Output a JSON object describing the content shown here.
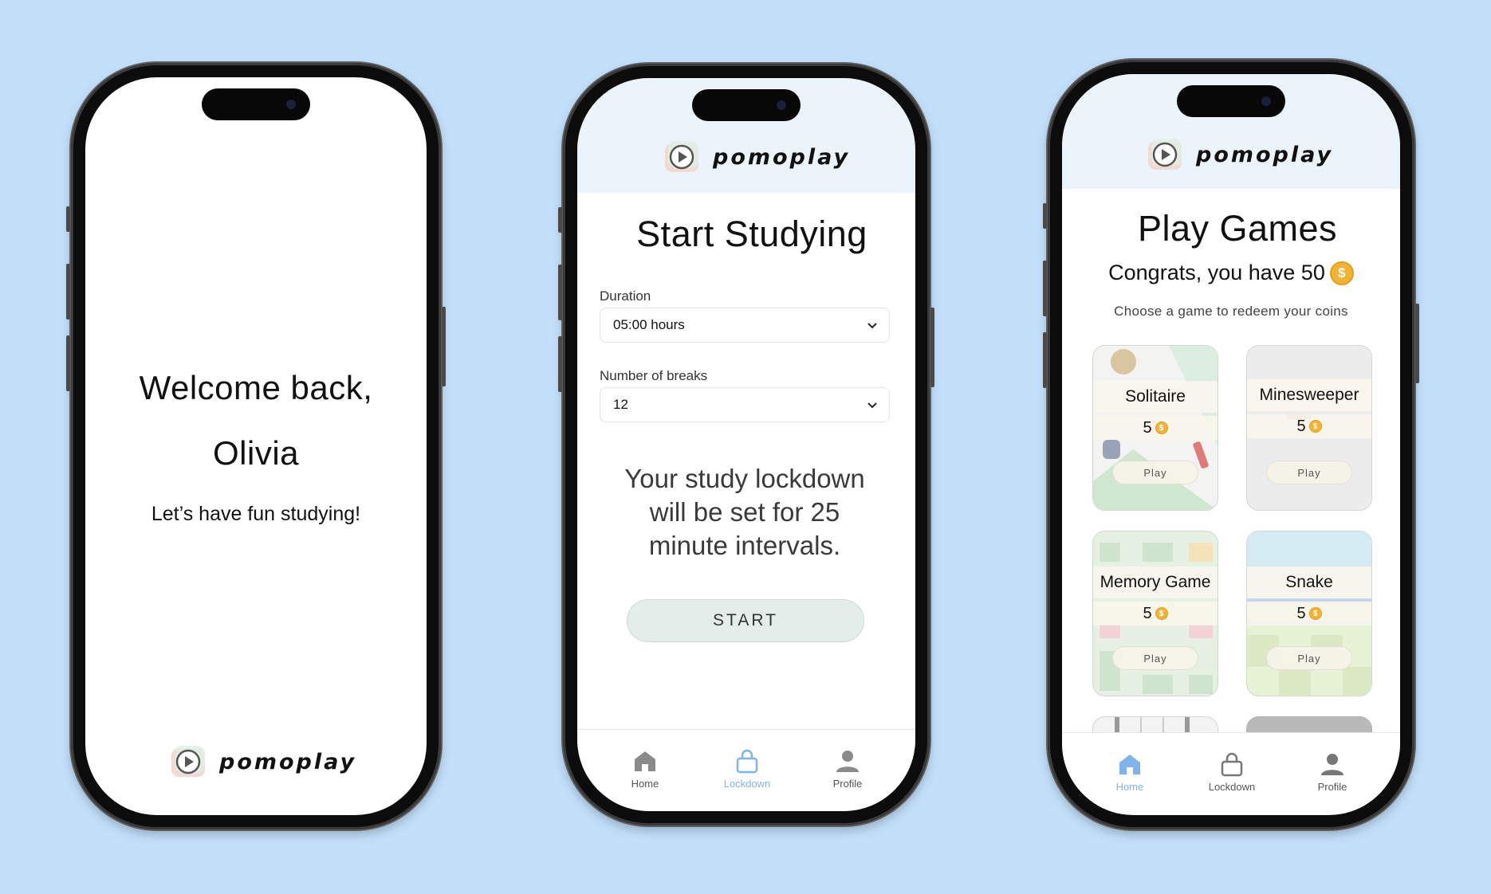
{
  "brand": {
    "name": "pomoplay"
  },
  "welcome_screen": {
    "greeting_line1": "Welcome back,",
    "greeting_line2": "Olivia",
    "subtitle": "Let’s have fun studying!"
  },
  "study_screen": {
    "title": "Start Studying",
    "duration": {
      "label": "Duration",
      "value": "05:00 hours"
    },
    "breaks": {
      "label": "Number of breaks",
      "value": "12"
    },
    "summary": [
      "Your study lockdown",
      "will be set for 25",
      "minute intervals."
    ],
    "start_label": "START",
    "tabs": [
      {
        "label": "Home",
        "icon": "home-icon",
        "active": false
      },
      {
        "label": "Lockdown",
        "icon": "lock-icon",
        "active": true
      },
      {
        "label": "Profile",
        "icon": "profile-icon",
        "active": false
      }
    ]
  },
  "games_screen": {
    "title": "Play Games",
    "coins_text": "Congrats, you have 50",
    "coins_symbol": "$",
    "subtitle": "Choose a game to redeem your coins",
    "games": [
      {
        "name": "Solitaire",
        "price": "5",
        "play_label": "Play"
      },
      {
        "name": "Minesweeper",
        "price": "5",
        "play_label": "Play"
      },
      {
        "name": "Memory Game",
        "price": "5",
        "play_label": "Play"
      },
      {
        "name": "Snake",
        "price": "5",
        "play_label": "Play"
      }
    ],
    "tabs": [
      {
        "label": "Home",
        "icon": "home-icon",
        "active": true
      },
      {
        "label": "Lockdown",
        "icon": "lock-icon",
        "active": false
      },
      {
        "label": "Profile",
        "icon": "profile-icon",
        "active": false
      }
    ]
  },
  "colors": {
    "background": "#c3e0fb",
    "header_bg": "#ebf3fb",
    "active_tab": "#7fb4ea",
    "coin": "#f2b233",
    "start_button": "#e3eeea"
  }
}
